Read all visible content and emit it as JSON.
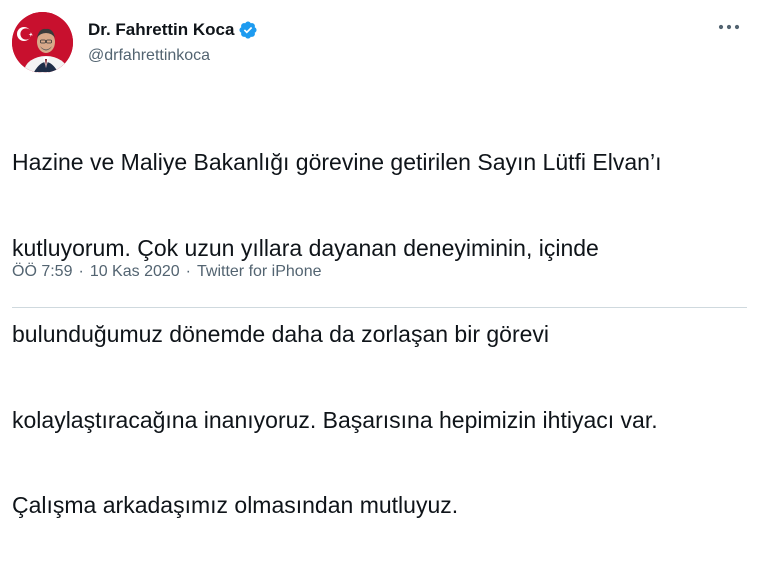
{
  "author": {
    "display_name": "Dr. Fahrettin Koca",
    "handle": "@drfahrettinkoca",
    "verified": true,
    "avatar_icon": "profile-photo",
    "verified_icon": "verified-badge-icon"
  },
  "tweet": {
    "text_lines": [
      "Hazine ve Maliye Bakanlığı görevine getirilen Sayın Lütfi Elvan’ı",
      "kutluyorum. Çok uzun yıllara dayanan deneyiminin, içinde",
      "bulunduğumuz dönemde daha da zorlaşan bir görevi",
      "kolaylaştıracağına inanıyoruz. Başarısına hepimizin ihtiyacı var.",
      "Çalışma arkadaşımız olmasından mutluyuz."
    ],
    "time": "ÖÖ 7:59",
    "separator": "·",
    "date": "10 Kas 2020",
    "source": "Twitter for iPhone"
  },
  "colors": {
    "text_primary": "#0f1419",
    "text_secondary": "#536471",
    "verified_blue": "#1d9bf0",
    "divider": "#cfd9de",
    "avatar_bg": "#c8102e"
  },
  "icons": {
    "more": "more-options-icon"
  }
}
